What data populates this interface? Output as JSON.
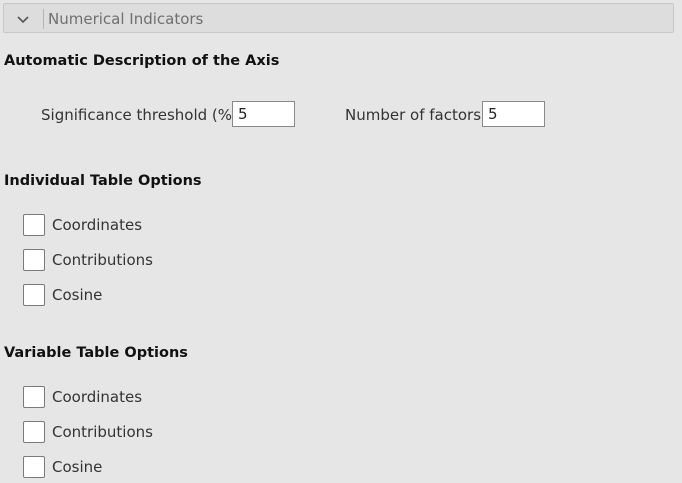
{
  "panel": {
    "title": "Numerical Indicators",
    "expanded": true,
    "toggle_icon": "chevron-down-icon"
  },
  "axis_description": {
    "title": "Automatic Description of the Axis",
    "significance_label": "Significance threshold (%)",
    "significance_value": "5",
    "factors_label": "Number of factors",
    "factors_value": "5"
  },
  "individual_table": {
    "title": "Individual Table Options",
    "options": [
      {
        "label": "Coordinates",
        "checked": false
      },
      {
        "label": "Contributions",
        "checked": false
      },
      {
        "label": "Cosine",
        "checked": false
      }
    ]
  },
  "variable_table": {
    "title": "Variable Table Options",
    "options": [
      {
        "label": "Coordinates",
        "checked": false
      },
      {
        "label": "Contributions",
        "checked": false
      },
      {
        "label": "Cosine",
        "checked": false
      }
    ]
  }
}
